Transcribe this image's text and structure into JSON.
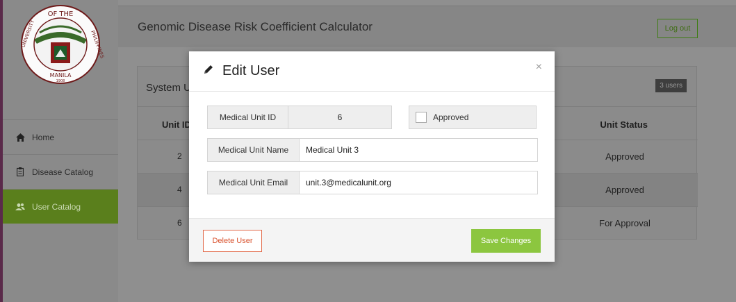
{
  "app": {
    "title": "Genomic Disease Risk Coefficient Calculator",
    "logout_label": "Log out"
  },
  "logo": {
    "top_text": "OF THE",
    "left_text": "UNIVERSITY",
    "right_text": "PHILIPPINES",
    "bottom_text": "MANILA",
    "year": "1908"
  },
  "sidebar": {
    "items": [
      {
        "label": "Home",
        "icon": "home-icon"
      },
      {
        "label": "Disease Catalog",
        "icon": "clipboard-icon"
      },
      {
        "label": "User Catalog",
        "icon": "users-icon",
        "active": true
      }
    ]
  },
  "panel": {
    "title": "System U",
    "count_badge": "3 users",
    "col_id": "Unit ID",
    "col_status": "Unit Status",
    "rows": [
      {
        "id": "2",
        "status": "Approved"
      },
      {
        "id": "4",
        "status": "Approved"
      },
      {
        "id": "6",
        "status": "For Approval"
      }
    ]
  },
  "modal": {
    "title": "Edit User",
    "close": "×",
    "id_label": "Medical Unit ID",
    "id_value": "6",
    "approved_label": "Approved",
    "approved_checked": false,
    "name_label": "Medical Unit Name",
    "name_value": "Medical Unit 3",
    "email_label": "Medical Unit Email",
    "email_value": "unit.3@medicalunit.org",
    "delete_label": "Delete User",
    "save_label": "Save Changes"
  },
  "colors": {
    "accent_green": "#8cc63f",
    "active_nav": "#5a7f1c",
    "delete_red": "#d9532f",
    "sidebar_border": "#5a2a4a"
  }
}
